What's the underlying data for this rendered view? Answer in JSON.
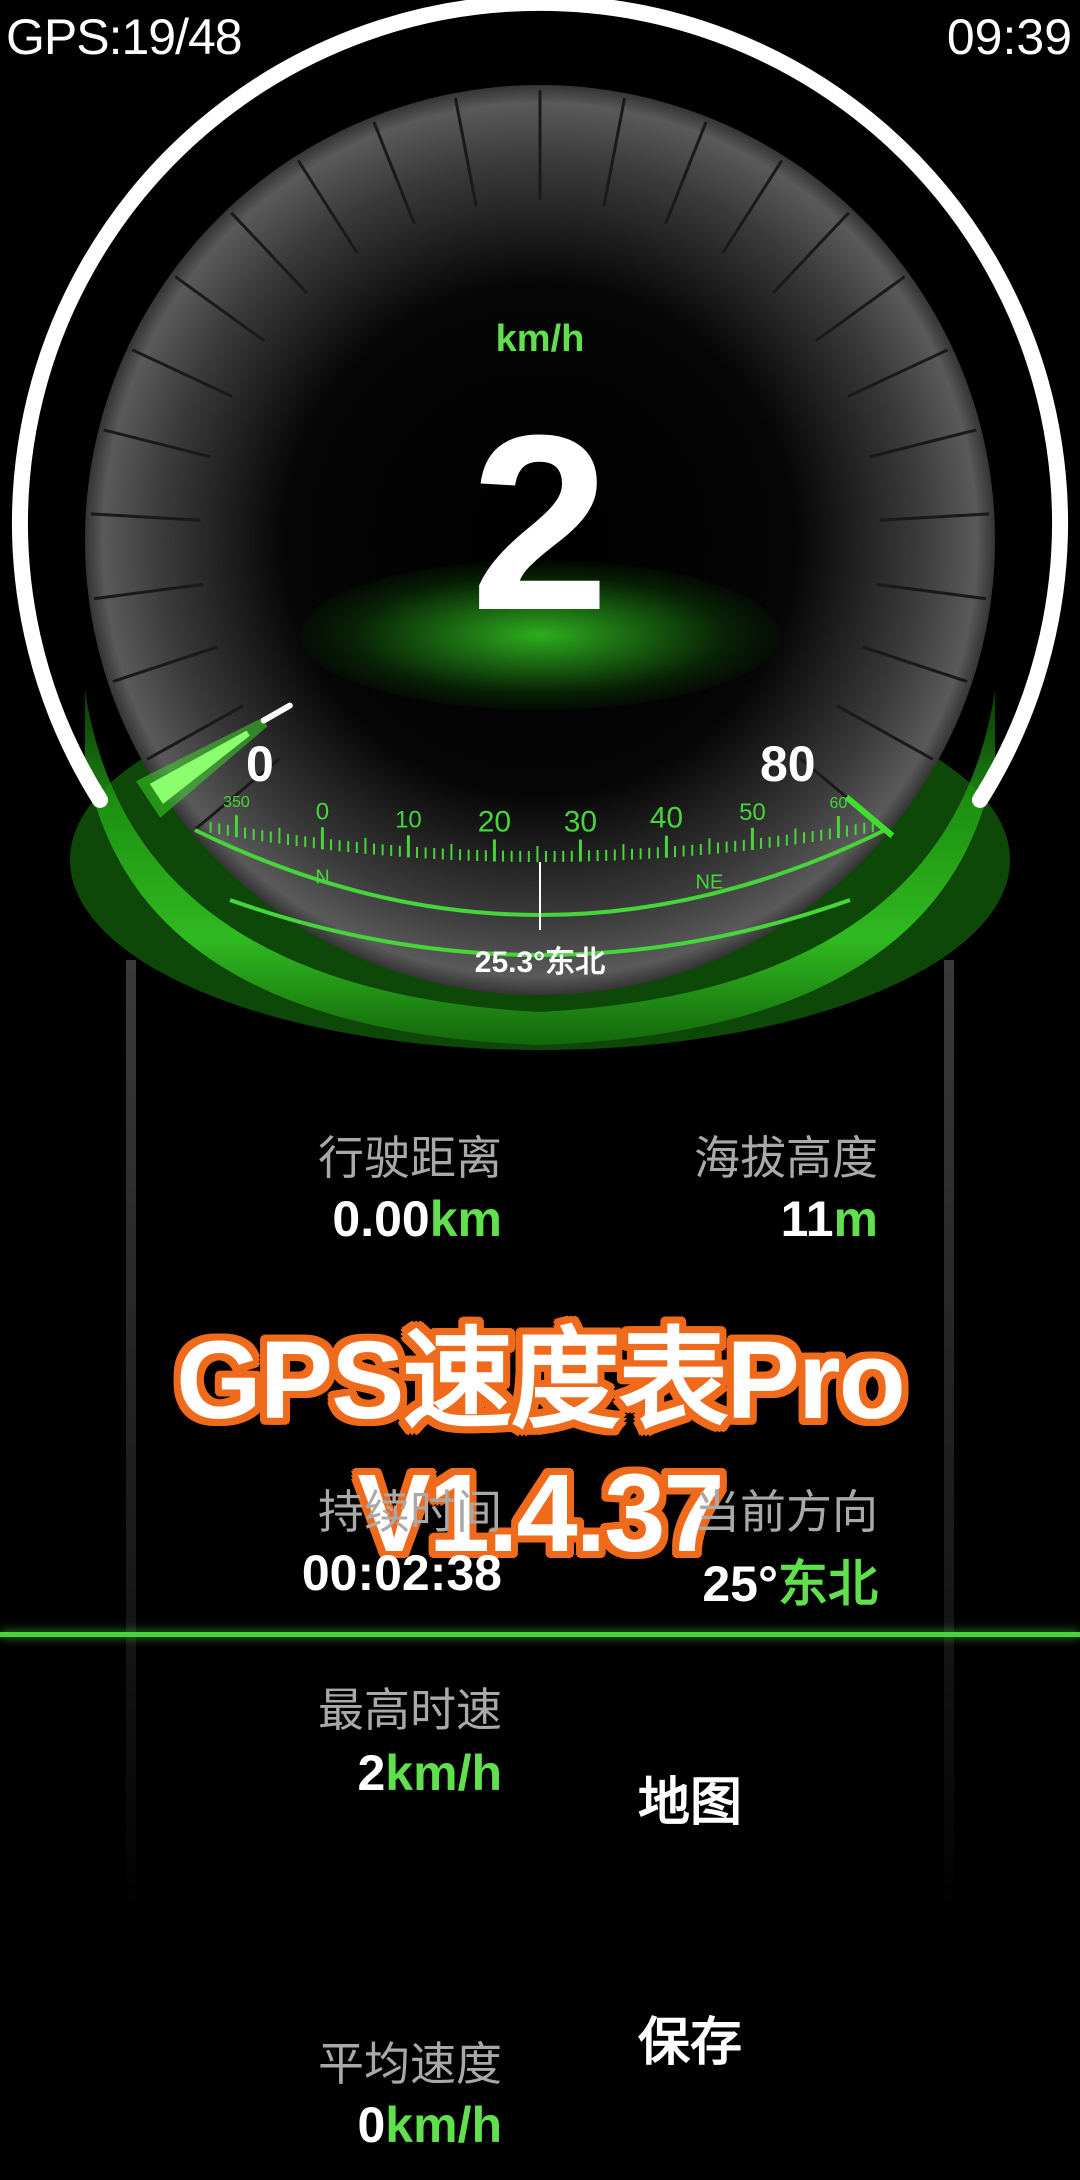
{
  "status_bar": {
    "gps": "GPS:19/48",
    "time": "09:39"
  },
  "speedometer": {
    "unit": "km/h",
    "speed": "2",
    "scale_min": "0",
    "scale_max": "80",
    "speed_fraction": 0.025
  },
  "compass": {
    "ticks": [
      "350",
      "0",
      "10",
      "20",
      "30",
      "40",
      "50",
      "60"
    ],
    "cardinals": [
      "N",
      "NE"
    ],
    "heading_readout": "25.3°东北",
    "heading_degrees": 25.3
  },
  "stats": {
    "distance": {
      "label": "行驶距离",
      "value": "0.00",
      "unit": "km"
    },
    "altitude": {
      "label": "海拔高度",
      "value": "11",
      "unit": "m"
    },
    "duration": {
      "label": "持续时间",
      "value": "00:02:38"
    },
    "direction": {
      "label": "当前方向",
      "value": "25°",
      "unit": "东北"
    },
    "max_speed": {
      "label": "最高时速",
      "value": "2",
      "unit": "km/h"
    },
    "avg_speed": {
      "label": "平均速度",
      "value": "0",
      "unit": "km/h"
    }
  },
  "banner": {
    "text": "GPS速度表Pro V1.4.37"
  },
  "actions": {
    "map_label": "地图",
    "save_label": "保存"
  },
  "colors": {
    "accent": "#5fe04c",
    "banner_outline": "#f06a1c",
    "background": "#000000"
  }
}
